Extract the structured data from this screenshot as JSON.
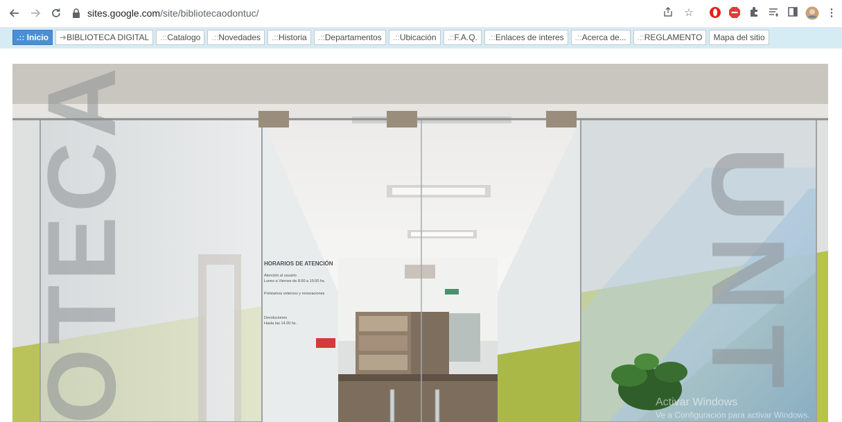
{
  "browser": {
    "url_host": "sites.google.com",
    "url_path": "/site/bibliotecaodontuc/"
  },
  "nav": {
    "tabs": [
      {
        "prefix": ".:: ",
        "label": "Inicio",
        "active": true
      },
      {
        "prefix": "➔",
        "label": "BIBLIOTECA DIGITAL",
        "active": false
      },
      {
        "prefix": ".::",
        "label": "Catalogo",
        "active": false
      },
      {
        "prefix": ".::",
        "label": "Novedades",
        "active": false
      },
      {
        "prefix": ".::",
        "label": "Historia",
        "active": false
      },
      {
        "prefix": ".::",
        "label": "Departamentos",
        "active": false
      },
      {
        "prefix": ".::",
        "label": "Ubicación",
        "active": false
      },
      {
        "prefix": ".::",
        "label": "F.A.Q.",
        "active": false
      },
      {
        "prefix": ".::",
        "label": "Enlaces de interes",
        "active": false
      },
      {
        "prefix": ".::",
        "label": "Acerca de...",
        "active": false
      },
      {
        "prefix": ".::",
        "label": "REGLAMENTO",
        "active": false
      },
      {
        "prefix": "",
        "label": "Mapa del sitio",
        "active": false
      }
    ]
  },
  "photo": {
    "left_glass_letters": "OTECA",
    "right_glass_letters": "UNT",
    "sign_title": "HORARIOS DE ATENCIÓN",
    "sign_line_1": "Atención al usuario",
    "sign_line_2": "Lunes a Viernes de 8.00 a 19.00 hs.",
    "sign_line_3": "Préstamos externos y renovaciones",
    "sign_line_4": "Devoluciones",
    "sign_line_5": "Hasta las 14.00 hs."
  },
  "watermark": {
    "title": "Activar Windows",
    "subtitle": "Ve a Configuración para activar Windows."
  },
  "colors": {
    "nav_background": "#d5ecf5",
    "active_tab": "#4a8fd4",
    "wall_green": "#b6c44a",
    "glass_blue": "#8fb3d4"
  }
}
